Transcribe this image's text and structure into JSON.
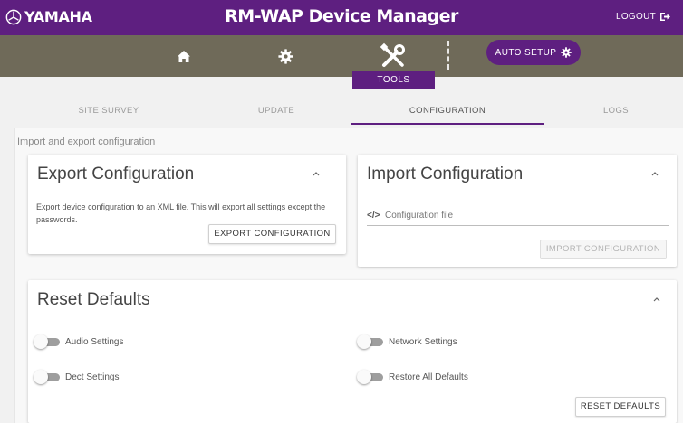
{
  "header": {
    "brand": "YAMAHA",
    "app_title": "RM-WAP Device Manager",
    "logout_label": "LOGOUT"
  },
  "nav": {
    "icons": [
      "home-icon",
      "gear-icon",
      "tools-icon"
    ],
    "auto_setup_label": "AUTO SETUP",
    "active_section_label": "TOOLS"
  },
  "tabs": [
    {
      "label": "SITE SURVEY",
      "active": false
    },
    {
      "label": "UPDATE",
      "active": false
    },
    {
      "label": "CONFIGURATION",
      "active": true
    },
    {
      "label": "LOGS",
      "active": false
    }
  ],
  "section_caption": "Import and export configuration",
  "export_card": {
    "title": "Export Configuration",
    "description": "Export device configuration to an XML file. This will export all settings except the passwords.",
    "button_label": "EXPORT CONFIGURATION"
  },
  "import_card": {
    "title": "Import Configuration",
    "file_icon_glyph": "</>",
    "file_placeholder": "Configuration file",
    "button_label": "IMPORT CONFIGURATION",
    "button_disabled": true
  },
  "reset_card": {
    "title": "Reset Defaults",
    "toggles": [
      {
        "label": "Audio Settings",
        "on": false
      },
      {
        "label": "Network Settings",
        "on": false
      },
      {
        "label": "Dect Settings",
        "on": false
      },
      {
        "label": "Restore All Defaults",
        "on": false
      }
    ],
    "button_label": "RESET DEFAULTS"
  },
  "colors": {
    "brand_purple": "#5e1f80",
    "nav_bar": "#6f6a59"
  }
}
